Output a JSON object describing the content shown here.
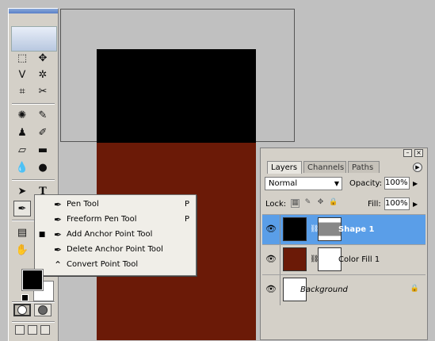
{
  "toolbox": {
    "tools": [
      {
        "name": "rectangular-marquee-tool",
        "glyph": "⬚"
      },
      {
        "name": "move-tool",
        "glyph": "✥"
      },
      {
        "name": "lasso-tool",
        "glyph": "ᐯ"
      },
      {
        "name": "magic-wand-tool",
        "glyph": "✲"
      },
      {
        "name": "crop-tool",
        "glyph": "⌗"
      },
      {
        "name": "slice-tool",
        "glyph": "✂"
      },
      {
        "name": "healing-brush-tool",
        "glyph": "✺"
      },
      {
        "name": "brush-tool",
        "glyph": "✎"
      },
      {
        "name": "clone-stamp-tool",
        "glyph": "♟"
      },
      {
        "name": "history-brush-tool",
        "glyph": "✐"
      },
      {
        "name": "eraser-tool",
        "glyph": "▱"
      },
      {
        "name": "gradient-tool",
        "glyph": "▬"
      },
      {
        "name": "blur-tool",
        "glyph": "💧"
      },
      {
        "name": "dodge-tool",
        "glyph": "●"
      },
      {
        "name": "path-selection-tool",
        "glyph": "➤"
      },
      {
        "name": "type-tool",
        "glyph": "T"
      },
      {
        "name": "pen-tool",
        "glyph": "✒"
      },
      {
        "name": "custom-shape-tool",
        "glyph": "▭"
      },
      {
        "name": "notes-tool",
        "glyph": "▤"
      },
      {
        "name": "eyedropper-tool",
        "glyph": "╱"
      },
      {
        "name": "hand-tool",
        "glyph": "✋"
      },
      {
        "name": "zoom-tool",
        "glyph": "🔍"
      }
    ],
    "foreground_color": "#000000",
    "background_color": "#ffffff"
  },
  "flyout": {
    "items": [
      {
        "icon": "pen-icon",
        "glyph": "✒",
        "label": "Pen Tool",
        "shortcut": "P",
        "active": false
      },
      {
        "icon": "freeform-pen-icon",
        "glyph": "✒",
        "label": "Freeform Pen Tool",
        "shortcut": "P",
        "active": false
      },
      {
        "icon": "add-anchor-point-icon",
        "glyph": "✒",
        "label": "Add Anchor Point Tool",
        "shortcut": "",
        "active": true
      },
      {
        "icon": "delete-anchor-point-icon",
        "glyph": "✒",
        "label": "Delete Anchor Point Tool",
        "shortcut": "",
        "active": false
      },
      {
        "icon": "convert-point-icon",
        "glyph": "⌃",
        "label": "Convert Point Tool",
        "shortcut": "",
        "active": false
      }
    ]
  },
  "canvas": {
    "black_shape_color": "#000000",
    "fill_color": "#6b1a07"
  },
  "layers_panel": {
    "tabs": [
      "Layers",
      "Channels",
      "Paths"
    ],
    "active_tab": "Layers",
    "blend_mode": "Normal",
    "opacity_label": "Opacity:",
    "opacity_value": "100%",
    "lock_label": "Lock:",
    "fill_label": "Fill:",
    "fill_value": "100%",
    "layers": [
      {
        "name": "Shape 1",
        "selected": true
      },
      {
        "name": "Color Fill 1",
        "selected": false
      },
      {
        "name": "Background",
        "selected": false
      }
    ]
  }
}
